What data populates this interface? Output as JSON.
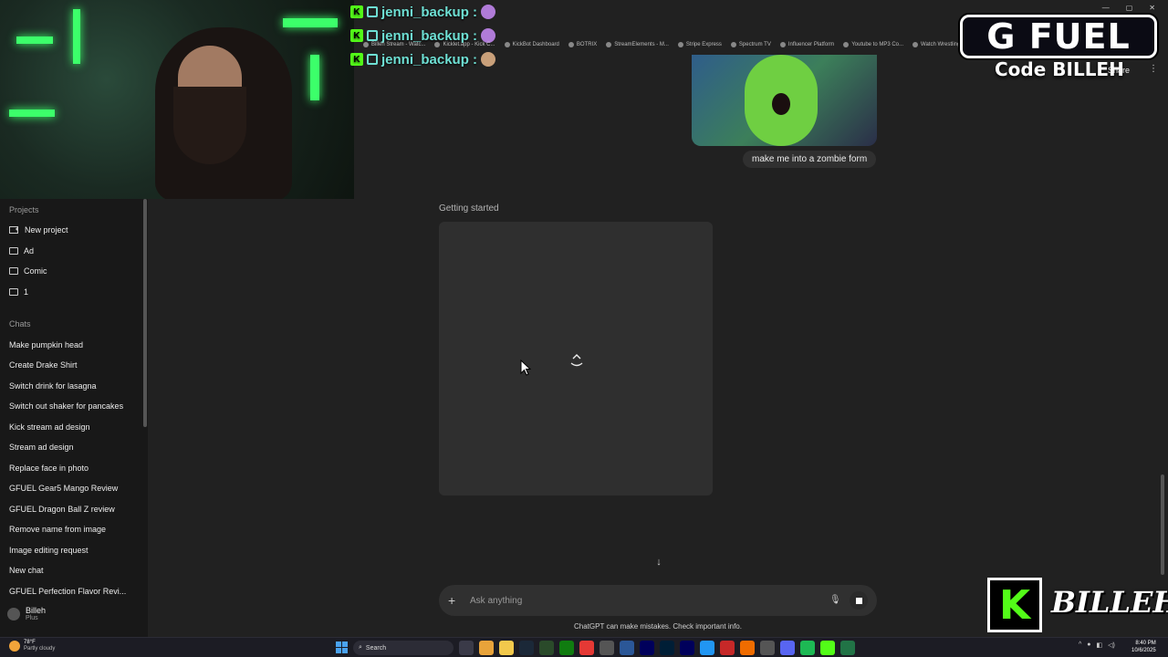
{
  "stream_chat": [
    {
      "user": "jenni_backup :"
    },
    {
      "user": "jenni_backup :"
    },
    {
      "user": "jenni_backup :"
    }
  ],
  "bookmarks": [
    "Billeh Stream - Watc...",
    "Kicklet.app - Kick C...",
    "KickBot Dashboard",
    "BOTRIX",
    "StreamElements - M...",
    "Stripe Express",
    "Spectrum TV",
    "Influencer Platform",
    "Youtube to MP3 Co...",
    "Watch Wrestling"
  ],
  "sponsor": {
    "brand": "G FUEL",
    "code_text": "Code BILLEH"
  },
  "header": {
    "share_label": "Share",
    "more": "⋮"
  },
  "sidebar": {
    "projects_label": "Projects",
    "projects": [
      {
        "label": "New project"
      },
      {
        "label": "Ad"
      },
      {
        "label": "Comic"
      },
      {
        "label": "1"
      }
    ],
    "chats_label": "Chats",
    "chats": [
      "Make pumpkin head",
      "Create Drake Shirt",
      "Switch drink for lasagna",
      "Switch out shaker for pancakes",
      "Kick stream ad design",
      "Stream ad design",
      "Replace face in photo",
      "GFUEL Gear5 Mango Review",
      "GFUEL Dragon Ball Z review",
      "Remove name from image",
      "Image editing request",
      "New chat",
      "GFUEL Perfection Flavor Revi..."
    ],
    "user": {
      "name": "Billeh",
      "plan": "Plus"
    }
  },
  "conversation": {
    "user_message": "make me into a zombie form",
    "status": "Getting started"
  },
  "composer": {
    "placeholder": "Ask anything",
    "disclaimer": "ChatGPT can make mistakes. Check important info."
  },
  "kick_overlay": {
    "name": "BILLEH"
  },
  "taskbar": {
    "weather_temp": "78°F",
    "weather_desc": "Partly cloudy",
    "search_label": "Search",
    "time": "8:40 PM",
    "date": "10/6/2025"
  },
  "colors": {
    "bg": "#212121",
    "sidebar": "#181818",
    "kick_green": "#53fc18",
    "chat_name": "#6ee0d4"
  }
}
